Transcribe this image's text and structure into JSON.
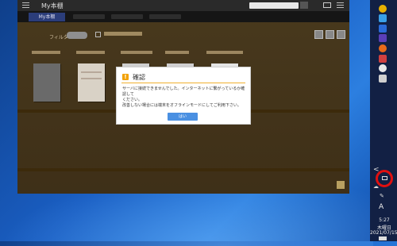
{
  "app": {
    "title": "My本棚",
    "tab_active": "My本棚",
    "filter_label": "フィルタ"
  },
  "dialog": {
    "title": "確認",
    "message": "サーバに接続できませんでした。インターネットに繋がっているか確認して\nください。\n改善しない場合には端末をオフラインモードにしてご利用下さい。",
    "ok_label": "はい"
  },
  "taskbar": {
    "caret": "<",
    "lang": "A",
    "time": "5:27",
    "day": "木曜日",
    "date": "2021/07/15"
  },
  "colors": {
    "dialog_accent": "#f0b030",
    "ok_button": "#4a90e2",
    "highlight_circle": "#e01010"
  }
}
